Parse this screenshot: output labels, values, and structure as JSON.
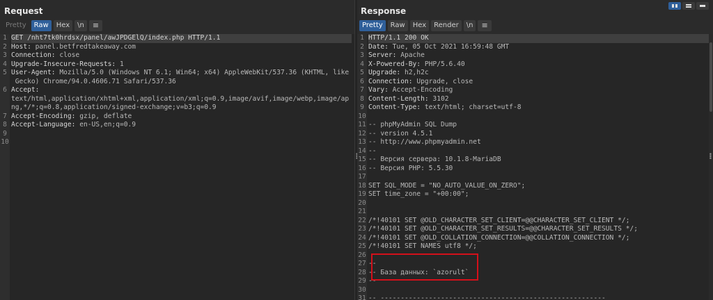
{
  "request": {
    "title": "Request",
    "tabs": [
      {
        "label": "Pretty",
        "state": "disabled"
      },
      {
        "label": "Raw",
        "state": "active"
      },
      {
        "label": "Hex",
        "state": "normal"
      },
      {
        "label": "\\n",
        "state": "normal"
      },
      {
        "label": "≡",
        "state": "menu"
      }
    ],
    "lines": [
      {
        "num": "1",
        "parts": [
          {
            "t": "GET /nht7tk0hrdsx/panel/awJPDGElQ/index.php HTTP/1.1",
            "c": "key"
          }
        ],
        "first": true
      },
      {
        "num": "2",
        "parts": [
          {
            "t": "Host: ",
            "c": "key"
          },
          {
            "t": "panel.betfredtakeaway.com",
            "c": "val"
          }
        ]
      },
      {
        "num": "3",
        "parts": [
          {
            "t": "Connection: ",
            "c": "key"
          },
          {
            "t": "close",
            "c": "val"
          }
        ]
      },
      {
        "num": "4",
        "parts": [
          {
            "t": "Upgrade-Insecure-Requests: ",
            "c": "key"
          },
          {
            "t": "1",
            "c": "val"
          }
        ]
      },
      {
        "num": "5",
        "parts": [
          {
            "t": "User-Agent: ",
            "c": "key"
          },
          {
            "t": "Mozilla/5.0 (Windows NT 6.1; Win64; x64) AppleWebKit/537.36 (KHTML, like",
            "c": "val"
          }
        ]
      },
      {
        "num": "",
        "parts": [
          {
            "t": " Gecko) Chrome/94.0.4606.71 Safari/537.36",
            "c": "val"
          }
        ]
      },
      {
        "num": "6",
        "parts": [
          {
            "t": "Accept:",
            "c": "key"
          }
        ]
      },
      {
        "num": "",
        "parts": [
          {
            "t": "text/html,application/xhtml+xml,application/xml;q=0.9,image/avif,image/webp,image/ap",
            "c": "val"
          }
        ]
      },
      {
        "num": "",
        "parts": [
          {
            "t": "ng,*/*;q=0.8,application/signed-exchange;v=b3;q=0.9",
            "c": "val"
          }
        ]
      },
      {
        "num": "7",
        "parts": [
          {
            "t": "Accept-Encoding: ",
            "c": "key"
          },
          {
            "t": "gzip, deflate",
            "c": "val"
          }
        ]
      },
      {
        "num": "8",
        "parts": [
          {
            "t": "Accept-Language: ",
            "c": "key"
          },
          {
            "t": "en-US,en;q=0.9",
            "c": "val"
          }
        ]
      },
      {
        "num": "9",
        "parts": []
      },
      {
        "num": "10",
        "parts": []
      }
    ]
  },
  "response": {
    "title": "Response",
    "tabs": [
      {
        "label": "Pretty",
        "state": "active"
      },
      {
        "label": "Raw",
        "state": "normal"
      },
      {
        "label": "Hex",
        "state": "normal"
      },
      {
        "label": "Render",
        "state": "normal"
      },
      {
        "label": "\\n",
        "state": "normal"
      },
      {
        "label": "≡",
        "state": "menu"
      }
    ],
    "lines": [
      {
        "num": "1",
        "parts": [
          {
            "t": "HTTP/1.1 200 OK",
            "c": "key"
          }
        ],
        "first": true
      },
      {
        "num": "2",
        "parts": [
          {
            "t": "Date: ",
            "c": "key"
          },
          {
            "t": "Tue, 05 Oct 2021 16:59:48 GMT",
            "c": "val"
          }
        ]
      },
      {
        "num": "3",
        "parts": [
          {
            "t": "Server: ",
            "c": "key"
          },
          {
            "t": "Apache",
            "c": "val"
          }
        ]
      },
      {
        "num": "4",
        "parts": [
          {
            "t": "X-Powered-By: ",
            "c": "key"
          },
          {
            "t": "PHP/5.6.40",
            "c": "val"
          }
        ]
      },
      {
        "num": "5",
        "parts": [
          {
            "t": "Upgrade: ",
            "c": "key"
          },
          {
            "t": "h2,h2c",
            "c": "val"
          }
        ]
      },
      {
        "num": "6",
        "parts": [
          {
            "t": "Connection: ",
            "c": "key"
          },
          {
            "t": "Upgrade, close",
            "c": "val"
          }
        ]
      },
      {
        "num": "7",
        "parts": [
          {
            "t": "Vary: ",
            "c": "key"
          },
          {
            "t": "Accept-Encoding",
            "c": "val"
          }
        ]
      },
      {
        "num": "8",
        "parts": [
          {
            "t": "Content-Length: ",
            "c": "key"
          },
          {
            "t": "3102",
            "c": "val"
          }
        ]
      },
      {
        "num": "9",
        "parts": [
          {
            "t": "Content-Type: ",
            "c": "key"
          },
          {
            "t": "text/html; charset=utf-8",
            "c": "val"
          }
        ]
      },
      {
        "num": "10",
        "parts": []
      },
      {
        "num": "11",
        "parts": [
          {
            "t": "-- phpMyAdmin SQL Dump",
            "c": "val"
          }
        ]
      },
      {
        "num": "12",
        "parts": [
          {
            "t": "-- version 4.5.1",
            "c": "val"
          }
        ]
      },
      {
        "num": "13",
        "parts": [
          {
            "t": "-- http://www.phpmyadmin.net",
            "c": "val"
          }
        ]
      },
      {
        "num": "14",
        "parts": [
          {
            "t": "--",
            "c": "val"
          }
        ]
      },
      {
        "num": "15",
        "parts": [
          {
            "t": "-- Версия сервера: 10.1.8-MariaDB",
            "c": "val"
          }
        ]
      },
      {
        "num": "16",
        "parts": [
          {
            "t": "-- Версия PHP: 5.5.30",
            "c": "val"
          }
        ]
      },
      {
        "num": "17",
        "parts": []
      },
      {
        "num": "18",
        "parts": [
          {
            "t": "SET SQL_MODE = \"NO_AUTO_VALUE_ON_ZERO\";",
            "c": "val"
          }
        ]
      },
      {
        "num": "19",
        "parts": [
          {
            "t": "SET time_zone = \"+00:00\";",
            "c": "val"
          }
        ]
      },
      {
        "num": "20",
        "parts": []
      },
      {
        "num": "21",
        "parts": []
      },
      {
        "num": "22",
        "parts": [
          {
            "t": "/*!40101 SET @OLD_CHARACTER_SET_CLIENT=@@CHARACTER_SET_CLIENT */;",
            "c": "val"
          }
        ]
      },
      {
        "num": "23",
        "parts": [
          {
            "t": "/*!40101 SET @OLD_CHARACTER_SET_RESULTS=@@CHARACTER_SET_RESULTS */;",
            "c": "val"
          }
        ]
      },
      {
        "num": "24",
        "parts": [
          {
            "t": "/*!40101 SET @OLD_COLLATION_CONNECTION=@@COLLATION_CONNECTION */;",
            "c": "val"
          }
        ]
      },
      {
        "num": "25",
        "parts": [
          {
            "t": "/*!40101 SET NAMES utf8 */;",
            "c": "val"
          }
        ]
      },
      {
        "num": "26",
        "parts": []
      },
      {
        "num": "27",
        "parts": [
          {
            "t": "--",
            "c": "val"
          }
        ]
      },
      {
        "num": "28",
        "parts": [
          {
            "t": "-- База данных: `azorult`",
            "c": "val"
          }
        ]
      },
      {
        "num": "29",
        "parts": [
          {
            "t": "--",
            "c": "val"
          }
        ]
      },
      {
        "num": "30",
        "parts": []
      },
      {
        "num": "31",
        "parts": [
          {
            "t": "-- --------------------------------------------------------",
            "c": "val"
          }
        ]
      }
    ]
  },
  "colors": {
    "background": "#2b2b2b",
    "active_tab": "#2f5f9a",
    "highlight_box": "#d4101a"
  }
}
